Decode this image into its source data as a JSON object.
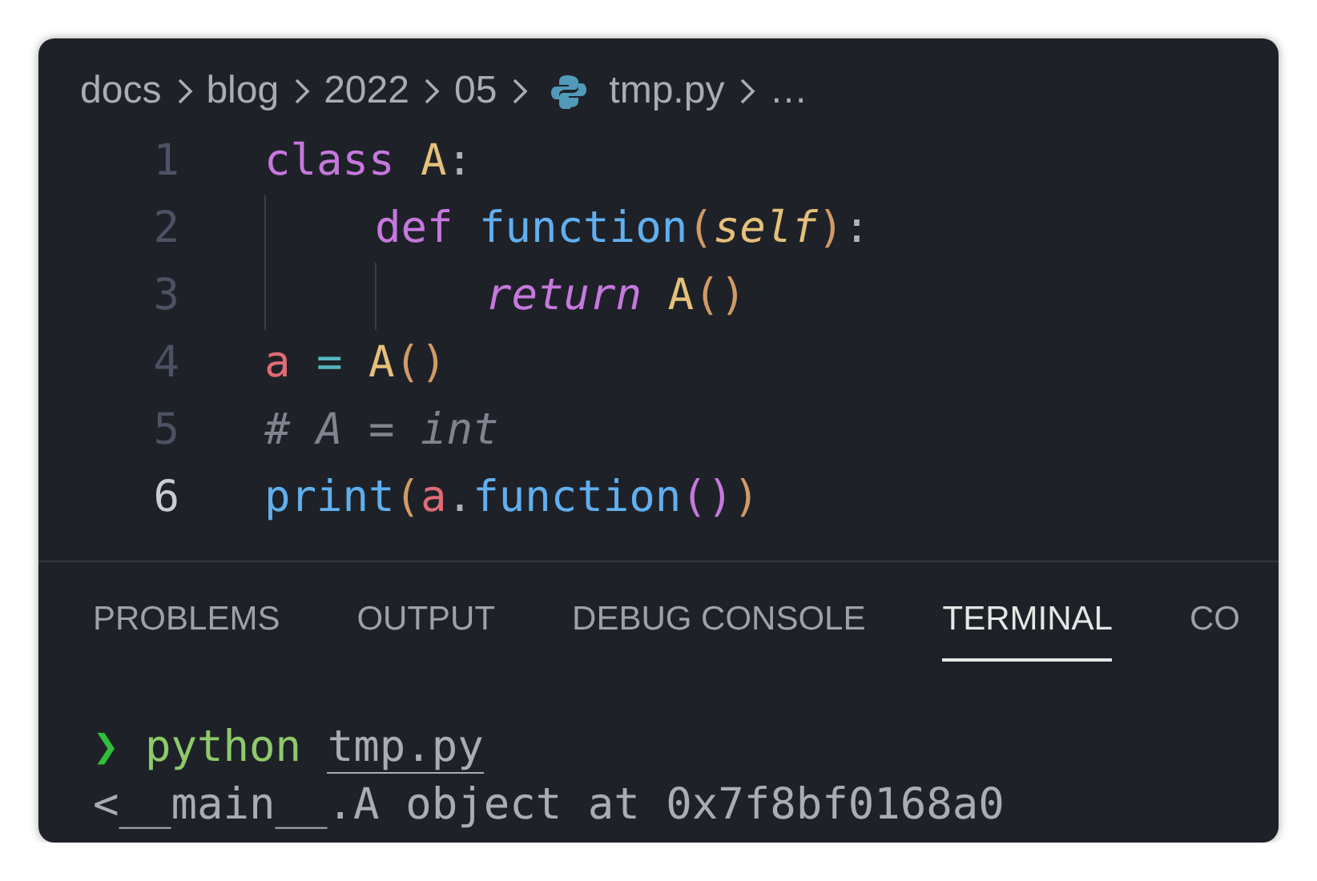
{
  "breadcrumb": [
    {
      "label": "docs",
      "kind": "folder"
    },
    {
      "label": "blog",
      "kind": "folder"
    },
    {
      "label": "2022",
      "kind": "folder"
    },
    {
      "label": "05",
      "kind": "folder"
    },
    {
      "label": "tmp.py",
      "kind": "python-file"
    },
    {
      "label": "…",
      "kind": "more"
    }
  ],
  "code": [
    {
      "number": "1",
      "current": false,
      "tokens": [
        {
          "text": "class",
          "kind": "keyword"
        },
        {
          "text": "A",
          "kind": "class",
          "spaced": true
        },
        {
          "text": ":",
          "kind": "punct"
        }
      ],
      "children": [
        {
          "number": "2",
          "current": false,
          "tokens": [
            {
              "text": "def",
              "kind": "keyword"
            },
            {
              "text": "function",
              "kind": "func",
              "spaced": true
            },
            {
              "text": "(",
              "kind": "bracket1"
            },
            {
              "text": "self",
              "kind": "param"
            },
            {
              "text": ")",
              "kind": "bracket1"
            },
            {
              "text": ":",
              "kind": "punct"
            }
          ],
          "children": [
            {
              "number": "3",
              "current": false,
              "tokens": [
                {
                  "text": "return",
                  "kind": "keyword-italic"
                },
                {
                  "text": "A",
                  "kind": "class",
                  "spaced": true
                },
                {
                  "text": "()",
                  "kind": "bracket1"
                }
              ]
            }
          ]
        }
      ]
    },
    {
      "number": "4",
      "current": false,
      "tokens": [
        {
          "text": "a",
          "kind": "var"
        },
        {
          "text": "=",
          "kind": "op",
          "spaced": true
        },
        {
          "text": "A",
          "kind": "class",
          "spaced": true
        },
        {
          "text": "()",
          "kind": "bracket1"
        }
      ]
    },
    {
      "number": "5",
      "current": false,
      "tokens": [
        {
          "text": "# A = int",
          "kind": "comment"
        }
      ]
    },
    {
      "number": "6",
      "current": true,
      "tokens": [
        {
          "text": "print",
          "kind": "func"
        },
        {
          "text": "(",
          "kind": "bracket1"
        },
        {
          "text": "a",
          "kind": "var"
        },
        {
          "text": ".",
          "kind": "punct"
        },
        {
          "text": "function",
          "kind": "func"
        },
        {
          "text": "()",
          "kind": "bracket2"
        },
        {
          "text": ")",
          "kind": "bracket1"
        }
      ]
    }
  ],
  "panel_tabs": [
    {
      "label": "PROBLEMS",
      "selected": false
    },
    {
      "label": "OUTPUT",
      "selected": false
    },
    {
      "label": "DEBUG CONSOLE",
      "selected": false
    },
    {
      "label": "TERMINAL",
      "selected": true
    },
    {
      "label": "CO",
      "selected": false
    }
  ],
  "terminal": {
    "prompt": "❯",
    "command": "python",
    "argument": "tmp.py",
    "output": "<__main__.A object at 0x7f8bf0168a0"
  }
}
